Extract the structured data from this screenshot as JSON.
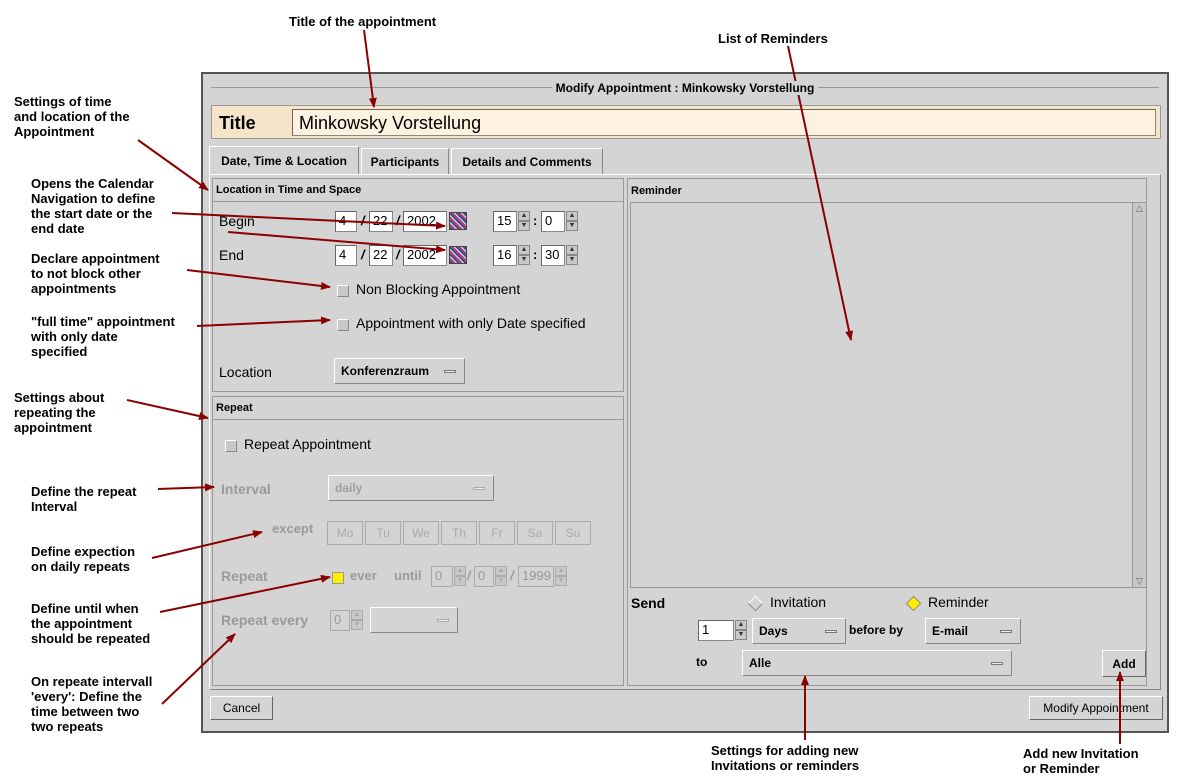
{
  "annotations": {
    "title_of_appointment": "Title of the appointment",
    "list_of_reminders": "List of Reminders",
    "settings_time_location": [
      "Settings  of time",
      "and location of the",
      "Appointment"
    ],
    "opens_calendar": [
      "Opens the Calendar",
      "Navigation to define",
      "the start date or the",
      "end date"
    ],
    "declare_nonblocking": [
      "Declare appointment",
      "to not block other",
      "appointments"
    ],
    "full_time": [
      "\"full time\" appointment",
      "with only date",
      "specified"
    ],
    "settings_repeat": [
      "Settings about",
      "repeating the",
      "appointment"
    ],
    "define_interval": [
      "Define the repeat",
      "Interval"
    ],
    "define_exception": [
      "Define expection",
      "on daily repeats"
    ],
    "define_until": [
      "Define until when",
      "the appointment",
      "should be repeated"
    ],
    "repeat_every": [
      "On repeate intervall",
      "'every': Define the",
      " time between two",
      "two repeats"
    ],
    "settings_adding": [
      "Settings for adding new",
      "Invitations or reminders"
    ],
    "add_new": [
      "Add new Invitation",
      "or Reminder"
    ]
  },
  "window": {
    "title": "Modify Appointment : Minkowsky Vorstellung",
    "title_label": "Title",
    "title_value": "Minkowsky Vorstellung",
    "tabs": [
      "Date, Time & Location",
      "Participants",
      "Details and Comments"
    ]
  },
  "location_group": {
    "header": "Location in Time and Space",
    "begin_label": "Begin",
    "end_label": "End",
    "begin": {
      "month": "4",
      "day": "22",
      "year": "2002",
      "hour": "15",
      "minute": "0"
    },
    "end": {
      "month": "4",
      "day": "22",
      "year": "2002",
      "hour": "16",
      "minute": "30"
    },
    "non_blocking_label": "Non Blocking Appointment",
    "date_only_label": "Appointment with only Date specified",
    "location_label": "Location",
    "location_value": "Konferenzraum"
  },
  "repeat_group": {
    "header": "Repeat",
    "repeat_checkbox_label": "Repeat Appointment",
    "interval_label": "Interval",
    "interval_value": "daily",
    "except_label": "except",
    "days": [
      "Mo",
      "Tu",
      "We",
      "Th",
      "Fr",
      "Sa",
      "Su"
    ],
    "repeat_label": "Repeat",
    "ever_label": "ever",
    "until_label": "until",
    "until": {
      "a": "0",
      "b": "0",
      "year": "1999"
    },
    "repeat_every_label": "Repeat every",
    "repeat_every_value": "0"
  },
  "reminder": {
    "header": "Reminder",
    "send_label": "Send",
    "invitation_label": "Invitation",
    "reminder_label": "Reminder",
    "count_value": "1",
    "unit_value": "Days",
    "before_by_label": "before by",
    "method_value": "E-mail",
    "to_label": "to",
    "to_value": "Alle",
    "add_label": "Add"
  },
  "buttons": {
    "cancel": "Cancel",
    "modify": "Modify Appointment"
  },
  "colors": {
    "arrow": "#8b0000",
    "title_bg": "#f5e4c8",
    "window_bg": "#d4d4d4",
    "radio_selected": "#ffee00"
  }
}
